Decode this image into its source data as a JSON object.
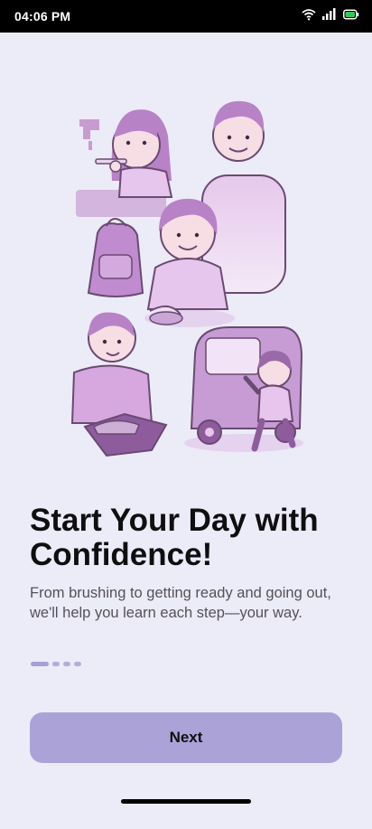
{
  "status_bar": {
    "time": "04:06 PM",
    "icons": [
      "wifi-icon",
      "signal-icon",
      "battery-icon"
    ]
  },
  "onboarding": {
    "illustration": "daily-routine-illustration",
    "title": "Start Your Day with Confidence!",
    "description": "From brushing to getting ready and going out, we'll help you learn each step—your way.",
    "page_indicator": {
      "total": 4,
      "active": 1
    },
    "next_label": "Next"
  },
  "colors": {
    "background": "#ECEBF8",
    "accent": "#ABA3D8",
    "illustration_purple": "#B88CC6",
    "title_text": "#0F0F10",
    "body_text": "#555158"
  }
}
